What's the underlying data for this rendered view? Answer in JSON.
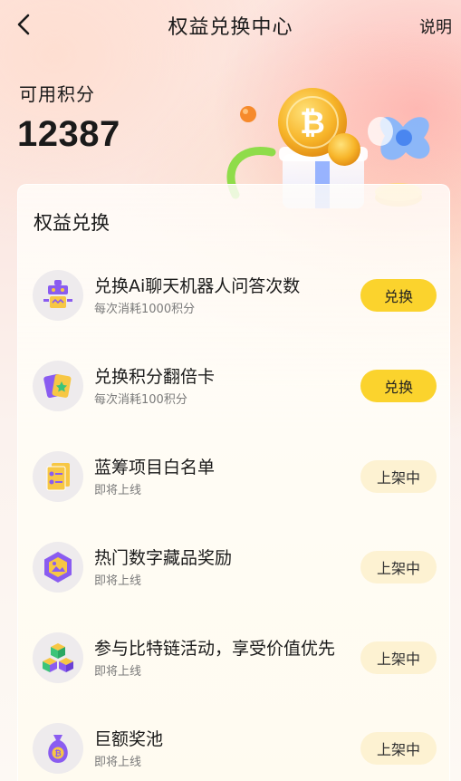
{
  "header": {
    "title": "权益兑换中心",
    "help_label": "说明"
  },
  "points": {
    "label": "可用积分",
    "value": "12387"
  },
  "section": {
    "title": "权益兑换"
  },
  "items": [
    {
      "title": "兑换Ai聊天机器人问答次数",
      "subtitle": "每次消耗1000积分",
      "button": "兑换",
      "status": "active",
      "icon": "robot-icon"
    },
    {
      "title": "兑换积分翻倍卡",
      "subtitle": "每次消耗100积分",
      "button": "兑换",
      "status": "active",
      "icon": "cards-icon"
    },
    {
      "title": "蓝筹项目白名单",
      "subtitle": "即将上线",
      "button": "上架中",
      "status": "coming-soon",
      "icon": "document-list-icon"
    },
    {
      "title": "热门数字藏品奖励",
      "subtitle": "即将上线",
      "button": "上架中",
      "status": "coming-soon",
      "icon": "nft-hexagon-icon"
    },
    {
      "title": "参与比特链活动，享受价值优先",
      "subtitle": "即将上线",
      "button": "上架中",
      "status": "coming-soon",
      "icon": "blocks-icon"
    },
    {
      "title": "巨额奖池",
      "subtitle": "即将上线",
      "button": "上架中",
      "status": "coming-soon",
      "icon": "money-bag-icon"
    }
  ],
  "colors": {
    "accent": "#fbd32d",
    "soon_button": "#fdf2d2",
    "icon_purple": "#8a5cf0",
    "icon_yellow": "#f7c744"
  }
}
